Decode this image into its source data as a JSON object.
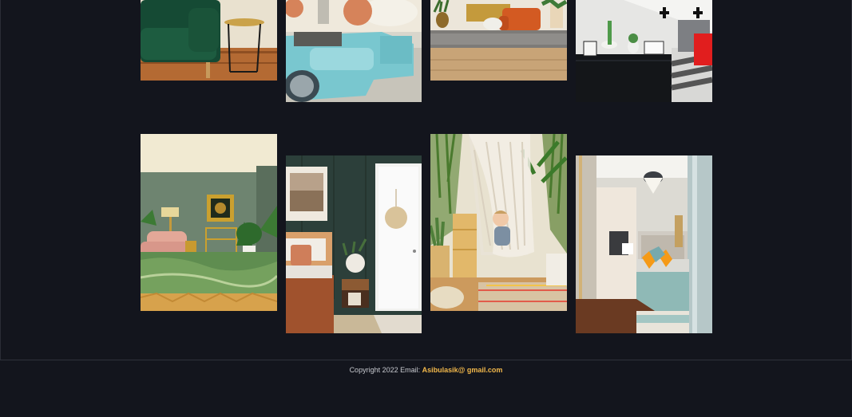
{
  "gallery": {
    "photos": [
      {
        "name": "green-velvet-sofa-photo"
      },
      {
        "name": "blue-coffee-table-living-room-photo"
      },
      {
        "name": "orange-sofa-living-room-photo"
      },
      {
        "name": "black-cabinet-bedroom-photo"
      },
      {
        "name": "sage-green-living-room-photo"
      },
      {
        "name": "dark-green-bedroom-photo"
      },
      {
        "name": "macrame-hammock-child-photo"
      },
      {
        "name": "narrow-bedroom-orange-pillows-photo"
      }
    ]
  },
  "footer": {
    "copyright": "Copyright 2022 Email:",
    "email": "Asibulasik@ gmail.com"
  },
  "colors": {
    "background": "#13151d",
    "email_accent": "#f2b84b"
  }
}
